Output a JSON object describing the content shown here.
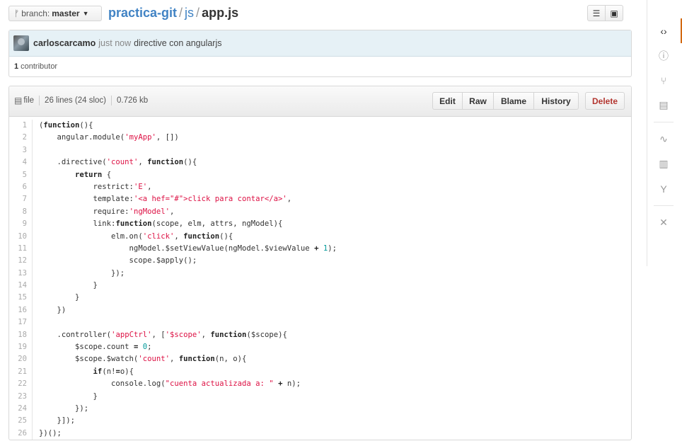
{
  "topbar": {
    "branch_prefix": "branch:",
    "branch_name": "master",
    "repo": "practica-git",
    "dir": "js",
    "file": "app.js",
    "separator": "/"
  },
  "commit": {
    "author": "carloscarcamo",
    "when": "just now",
    "message": "directive con angularjs",
    "contributors_count": "1",
    "contributors_label": "contributor"
  },
  "file": {
    "type_label": "file",
    "lines_info": "26 lines (24 sloc)",
    "size": "0.726 kb",
    "actions": {
      "edit": "Edit",
      "raw": "Raw",
      "blame": "Blame",
      "history": "History",
      "delete": "Delete"
    }
  },
  "code_lines": [
    "(function(){",
    "    angular.module('myApp', [])",
    "",
    "    .directive('count', function(){",
    "        return {",
    "            restrict:'E',",
    "            template:'<a hef=\"#\">click para contar</a>',",
    "            require:'ngModel',",
    "            link:function(scope, elm, attrs, ngModel){",
    "                elm.on('click', function(){",
    "                    ngModel.$setViewValue(ngModel.$viewValue + 1);",
    "                    scope.$apply();",
    "                });",
    "            }",
    "        }",
    "    })",
    "",
    "    .controller('appCtrl', ['$scope', function($scope){",
    "        $scope.count = 0;",
    "        $scope.$watch('count', function(n, o){",
    "            if(n!=o){",
    "                console.log(\"cuenta actualizada a: \" + n);",
    "            }",
    "        });",
    "    }]);",
    "})();"
  ],
  "right_nav": [
    {
      "icon": "code-icon",
      "glyph": "‹›"
    },
    {
      "icon": "issues-icon",
      "glyph": "ⓘ"
    },
    {
      "icon": "pull-requests-icon",
      "glyph": "⑂"
    },
    {
      "icon": "wiki-icon",
      "glyph": "▤"
    },
    {
      "icon": "pulse-icon",
      "glyph": "∿"
    },
    {
      "icon": "graphs-icon",
      "glyph": "▥"
    },
    {
      "icon": "network-icon",
      "glyph": "Y"
    },
    {
      "icon": "settings-icon",
      "glyph": "✕"
    }
  ]
}
